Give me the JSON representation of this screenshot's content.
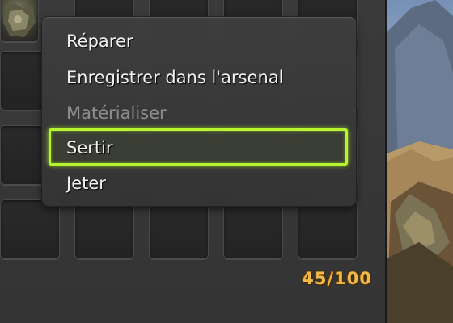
{
  "inventory": {
    "counter": "45/100"
  },
  "context_menu": {
    "items": [
      {
        "label": "Réparer",
        "enabled": true,
        "selected": false
      },
      {
        "label": "Enregistrer dans l'arsenal",
        "enabled": true,
        "selected": false
      },
      {
        "label": "Matérialiser",
        "enabled": false,
        "selected": false
      },
      {
        "label": "Sertir",
        "enabled": true,
        "selected": true
      },
      {
        "label": "Jeter",
        "enabled": true,
        "selected": false
      }
    ],
    "highlight_color": "#b6f52f"
  },
  "colors": {
    "counter": "#f2b84a",
    "panel": "#383838",
    "menu_text": "#f1f1f1",
    "disabled_text": "#8e8e8e"
  }
}
